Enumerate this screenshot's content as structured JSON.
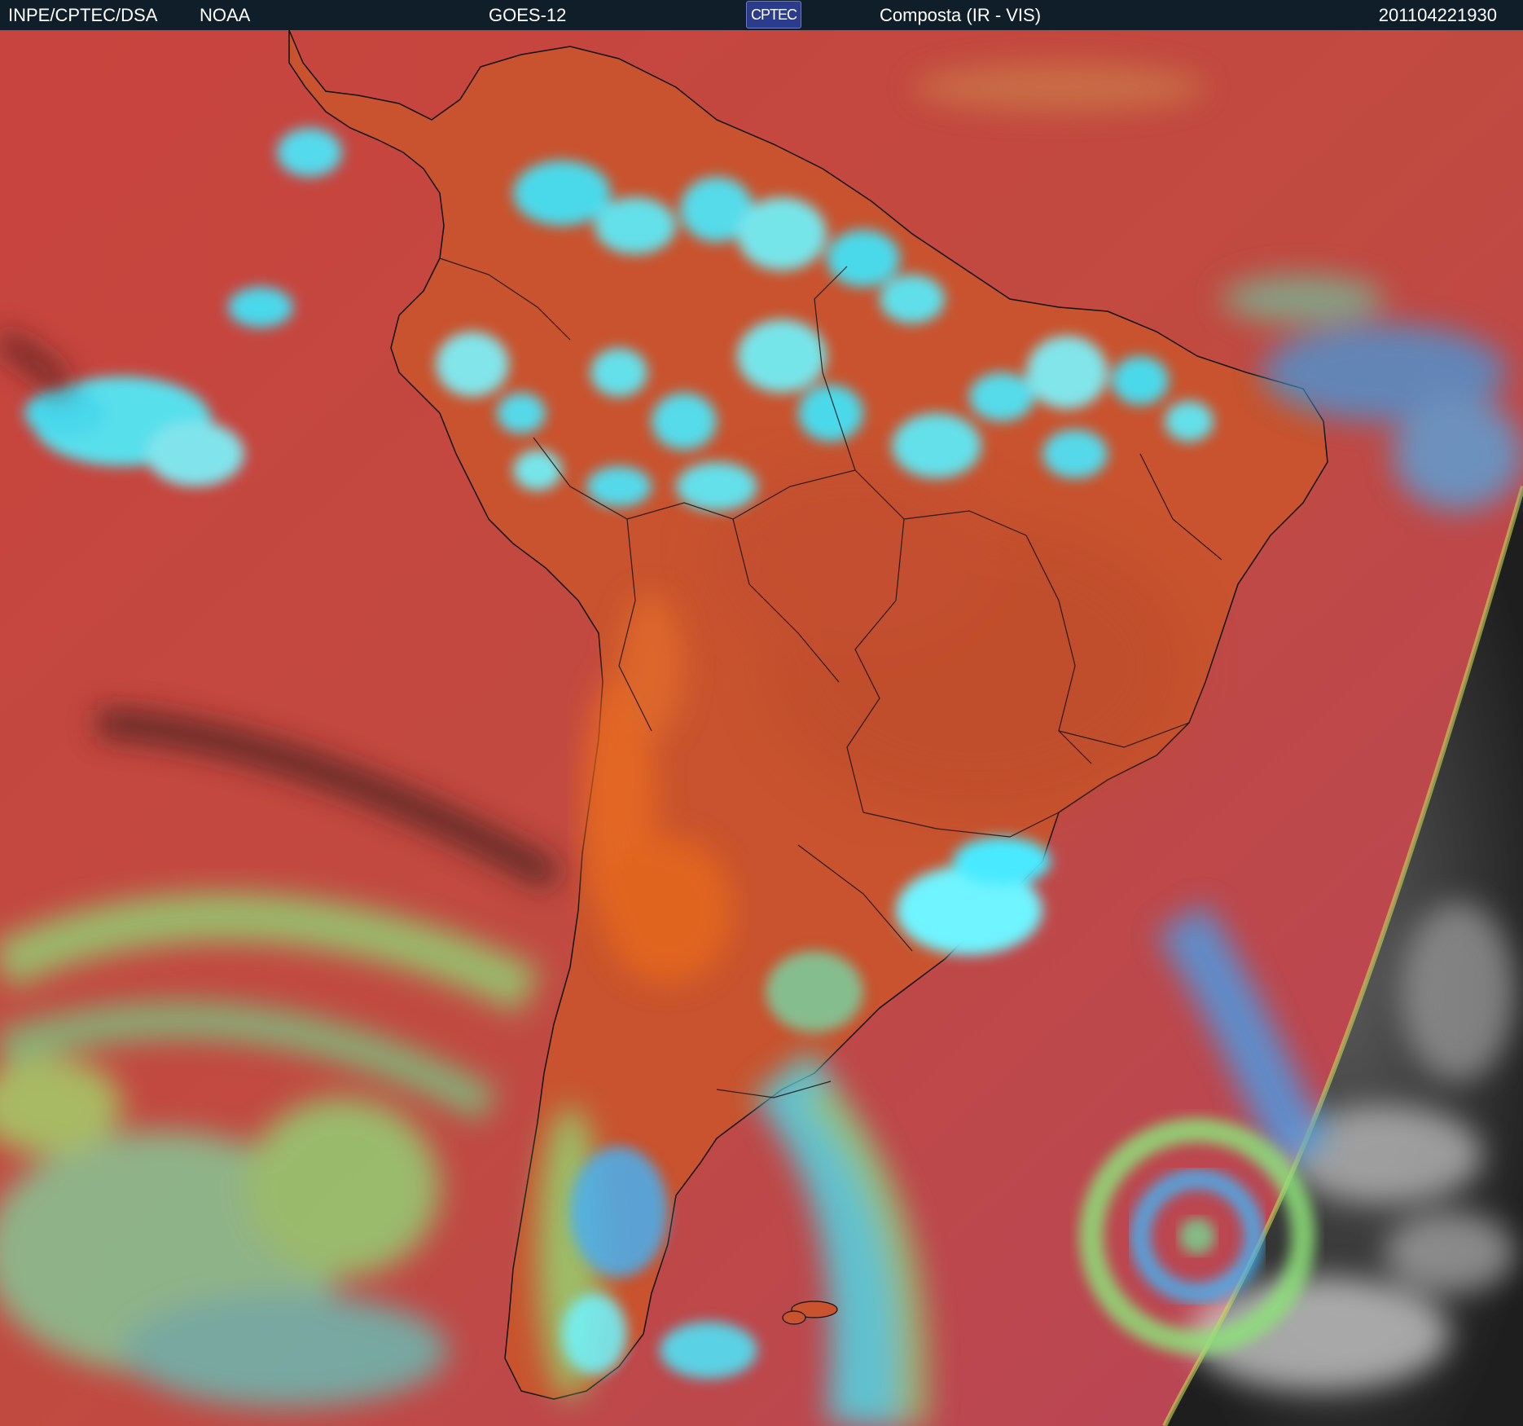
{
  "header": {
    "institution": "INPE/CPTEC/DSA",
    "agency": "NOAA",
    "satellite": "GOES-12",
    "logo_text": "CPTEC",
    "product": "Composta (IR - VIS)",
    "timestamp": "201104221930"
  },
  "colors": {
    "ocean_clear": "#c24a3e",
    "land_clear": "#c9542c",
    "high_cloud": "#4ef0ff",
    "low_cloud": "#8ee07a",
    "night_side": "#2a2a2a",
    "coastline": "#000000"
  }
}
